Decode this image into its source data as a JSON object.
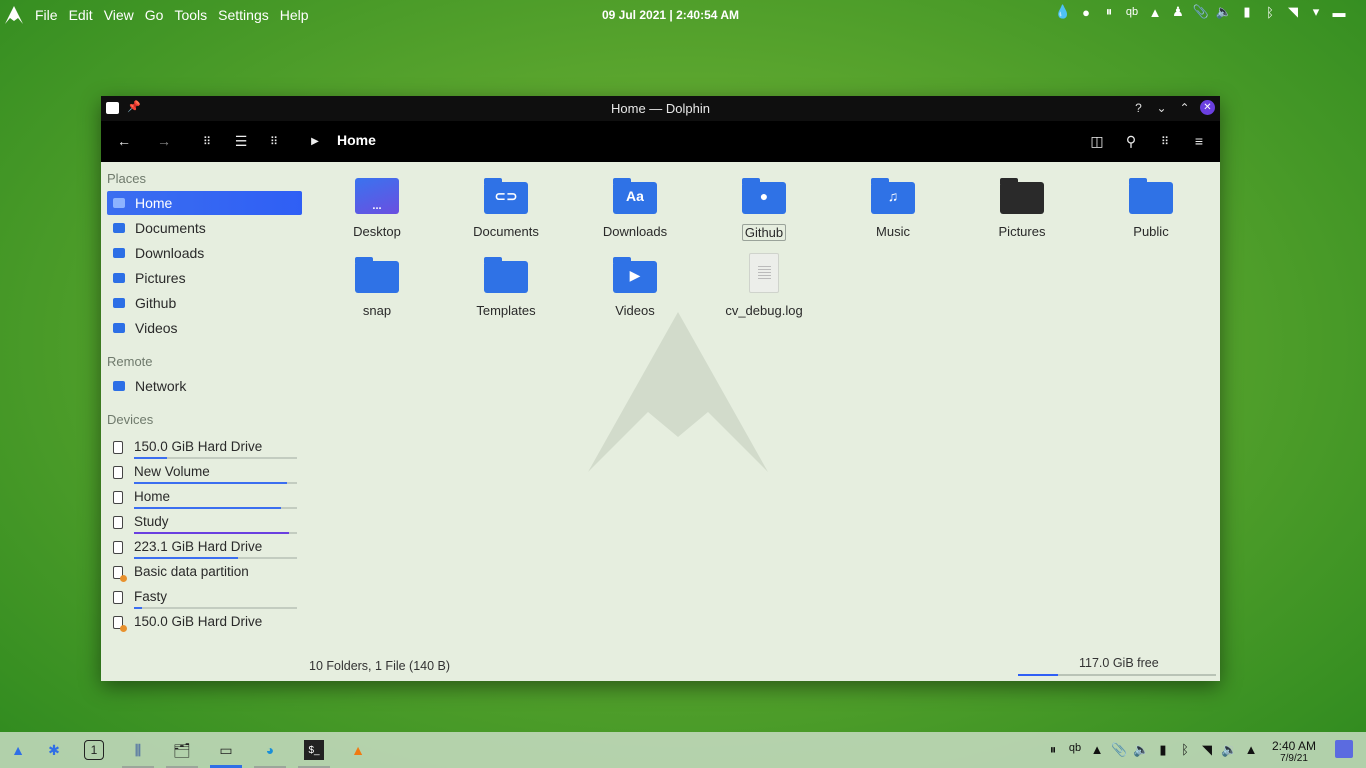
{
  "topbar": {
    "menu": [
      "File",
      "Edit",
      "View",
      "Go",
      "Tools",
      "Settings",
      "Help"
    ],
    "clock": "09 Jul 2021 | 2:40:54 AM",
    "tray_icons": [
      "droplet-icon",
      "circle-icon",
      "pause-icon",
      "qbittorrent-icon",
      "vlc-icon",
      "user-icon",
      "paperclip-icon",
      "volume-icon",
      "battery-icon",
      "bluetooth-icon",
      "wifi-icon",
      "chevron-down-icon",
      "folder-icon"
    ]
  },
  "window": {
    "title": "Home — Dolphin",
    "help": "?",
    "breadcrumb": "Home"
  },
  "sidebar": {
    "places_title": "Places",
    "places": [
      "Home",
      "Documents",
      "Downloads",
      "Pictures",
      "Github",
      "Videos"
    ],
    "remote_title": "Remote",
    "remote": [
      "Network"
    ],
    "devices_title": "Devices",
    "devices": [
      {
        "label": "150.0 GiB Hard Drive",
        "usage": 0.2,
        "color": "#3b6ef0",
        "warn": false
      },
      {
        "label": "New Volume",
        "usage": 0.94,
        "color": "#3b6ef0",
        "warn": false
      },
      {
        "label": "Home",
        "usage": 0.9,
        "color": "#3b6ef0",
        "warn": false
      },
      {
        "label": "Study",
        "usage": 0.95,
        "color": "#6a3fe0",
        "warn": false
      },
      {
        "label": "223.1 GiB Hard Drive",
        "usage": 0.64,
        "color": "#3b6ef0",
        "warn": false
      },
      {
        "label": "Basic data partition",
        "usage": null,
        "color": "",
        "warn": true
      },
      {
        "label": "Fasty",
        "usage": 0.05,
        "color": "#3b6ef0",
        "warn": false
      },
      {
        "label": "150.0 GiB Hard Drive",
        "usage": null,
        "color": "",
        "warn": true
      }
    ]
  },
  "files": [
    {
      "name": "Desktop",
      "kind": "desktop"
    },
    {
      "name": "Documents",
      "kind": "folder",
      "glyph": "⊂⊃"
    },
    {
      "name": "Downloads",
      "kind": "folder",
      "glyph": "Aa"
    },
    {
      "name": "Github",
      "kind": "folder",
      "glyph": "●",
      "selected": true
    },
    {
      "name": "Music",
      "kind": "folder",
      "glyph": "♫"
    },
    {
      "name": "Pictures",
      "kind": "pictures"
    },
    {
      "name": "Public",
      "kind": "folder",
      "glyph": ""
    },
    {
      "name": "snap",
      "kind": "folder",
      "glyph": ""
    },
    {
      "name": "Templates",
      "kind": "folder",
      "glyph": ""
    },
    {
      "name": "Videos",
      "kind": "folder",
      "glyph": "▶"
    },
    {
      "name": "cv_debug.log",
      "kind": "file"
    }
  ],
  "status": {
    "summary": "10 Folders, 1 File (140 B)",
    "free": "117.0 GiB free",
    "free_fraction": 0.2
  },
  "taskbar": {
    "workspace": "1",
    "time": "2:40 AM",
    "date": "7/9/21"
  },
  "colors": {
    "accent": "#3b6ef0",
    "folder": "#2f72e6",
    "close": "#6a3fe0"
  }
}
